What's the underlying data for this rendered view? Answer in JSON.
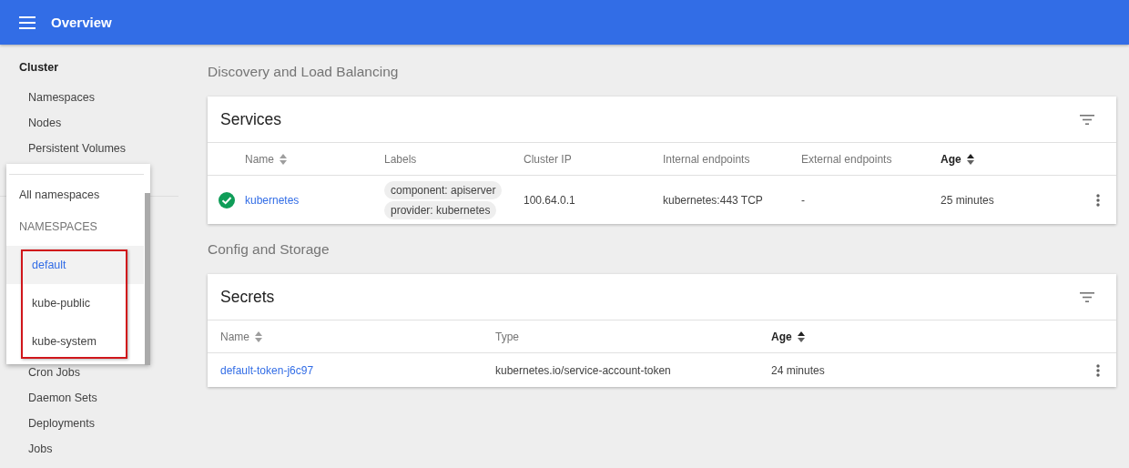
{
  "header": {
    "title": "Overview"
  },
  "sidebar": {
    "heading": "Cluster",
    "items": [
      "Namespaces",
      "Nodes",
      "Persistent Volumes"
    ],
    "lower_items": [
      "Cron Jobs",
      "Daemon Sets",
      "Deployments",
      "Jobs"
    ]
  },
  "namespace_menu": {
    "all": "All namespaces",
    "heading": "NAMESPACES",
    "items": [
      {
        "label": "default",
        "selected": true
      },
      {
        "label": "kube-public",
        "selected": false
      },
      {
        "label": "kube-system",
        "selected": false
      }
    ]
  },
  "sections": [
    {
      "title": "Discovery and Load Balancing",
      "card": {
        "title": "Services",
        "kind": "services",
        "columns": [
          {
            "label": "Name",
            "sortable": true,
            "sorted": false
          },
          {
            "label": "Labels",
            "sortable": false,
            "sorted": false
          },
          {
            "label": "Cluster IP",
            "sortable": false,
            "sorted": false
          },
          {
            "label": "Internal endpoints",
            "sortable": false,
            "sorted": false
          },
          {
            "label": "External endpoints",
            "sortable": false,
            "sorted": false
          },
          {
            "label": "Age",
            "sortable": true,
            "sorted": true
          }
        ],
        "rows": [
          {
            "ok": true,
            "name": "kubernetes",
            "labels": [
              "component: apiserver",
              "provider: kubernetes"
            ],
            "cluster_ip": "100.64.0.1",
            "internal": "kubernetes:443 TCP",
            "external": "-",
            "age": "25 minutes"
          }
        ]
      }
    },
    {
      "title": "Config and Storage",
      "card": {
        "title": "Secrets",
        "kind": "secrets",
        "columns": [
          {
            "label": "Name",
            "sortable": true,
            "sorted": false
          },
          {
            "label": "Type",
            "sortable": false,
            "sorted": false
          },
          {
            "label": "Age",
            "sortable": true,
            "sorted": true
          }
        ],
        "rows": [
          {
            "name": "default-token-j6c97",
            "type": "kubernetes.io/service-account-token",
            "age": "24 minutes"
          }
        ]
      }
    }
  ]
}
